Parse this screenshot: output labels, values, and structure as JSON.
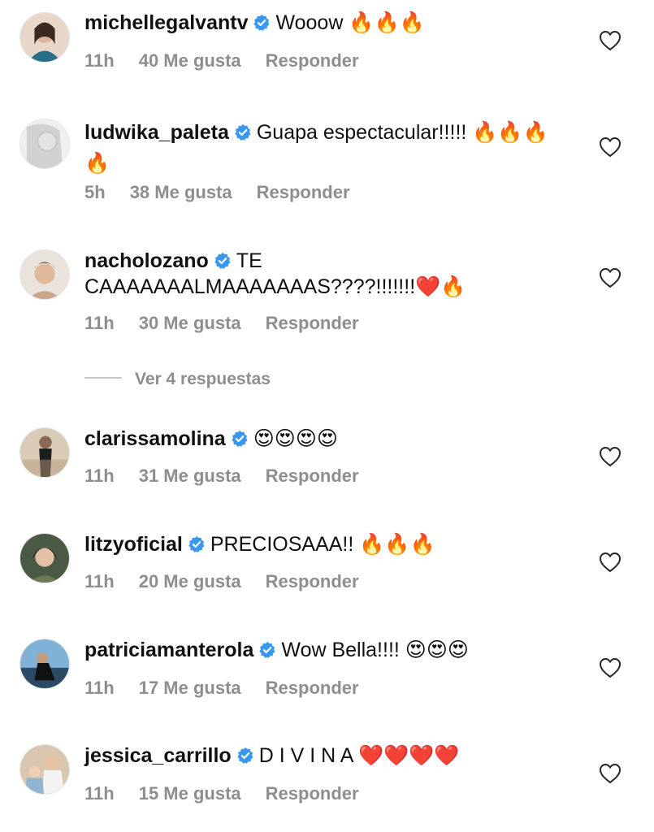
{
  "comments": [
    {
      "username": "michellegalvantv",
      "text": "Wooow 🔥🔥🔥",
      "time": "11h",
      "likes": "40 Me gusta",
      "reply": "Responder",
      "avatar_color": "#2a6f8a"
    },
    {
      "username": "ludwika_paleta",
      "text": "Guapa espectacular!!!!! 🔥🔥🔥🔥",
      "time": "5h",
      "likes": "38 Me gusta",
      "reply": "Responder",
      "avatar_color": "#bdbdbd"
    },
    {
      "username": "nacholozano",
      "text": "TE CAAAAAAALMAAAAAAAS????!!!!!!!❤️🔥",
      "time": "11h",
      "likes": "30 Me gusta",
      "reply": "Responder",
      "avatar_color": "#c9a48a"
    },
    {
      "username": "clarissamolina",
      "text": "😍😍😍😍",
      "time": "11h",
      "likes": "31 Me gusta",
      "reply": "Responder",
      "avatar_color": "#7a5a4a"
    },
    {
      "username": "litzyoficial",
      "text": "PRECIOSAAA!! 🔥🔥🔥",
      "time": "11h",
      "likes": "20 Me gusta",
      "reply": "Responder",
      "avatar_color": "#3b4a3a"
    },
    {
      "username": "patriciamanterola",
      "text": "Wow Bella!!!! 😍😍😍",
      "time": "11h",
      "likes": "17 Me gusta",
      "reply": "Responder",
      "avatar_color": "#4d7fa6"
    },
    {
      "username": "jessica_carrillo",
      "text": "D I V I N A ❤️❤️❤️❤️",
      "time": "11h",
      "likes": "15 Me gusta",
      "reply": "Responder",
      "avatar_color": "#a08466"
    }
  ],
  "view_replies": "Ver 4 respuestas",
  "colors": {
    "verified": "#3897f0",
    "muted": "#8e8e8e",
    "text": "#111111"
  },
  "icons": {
    "verified": "verified-badge-icon",
    "like": "heart-outline-icon"
  }
}
